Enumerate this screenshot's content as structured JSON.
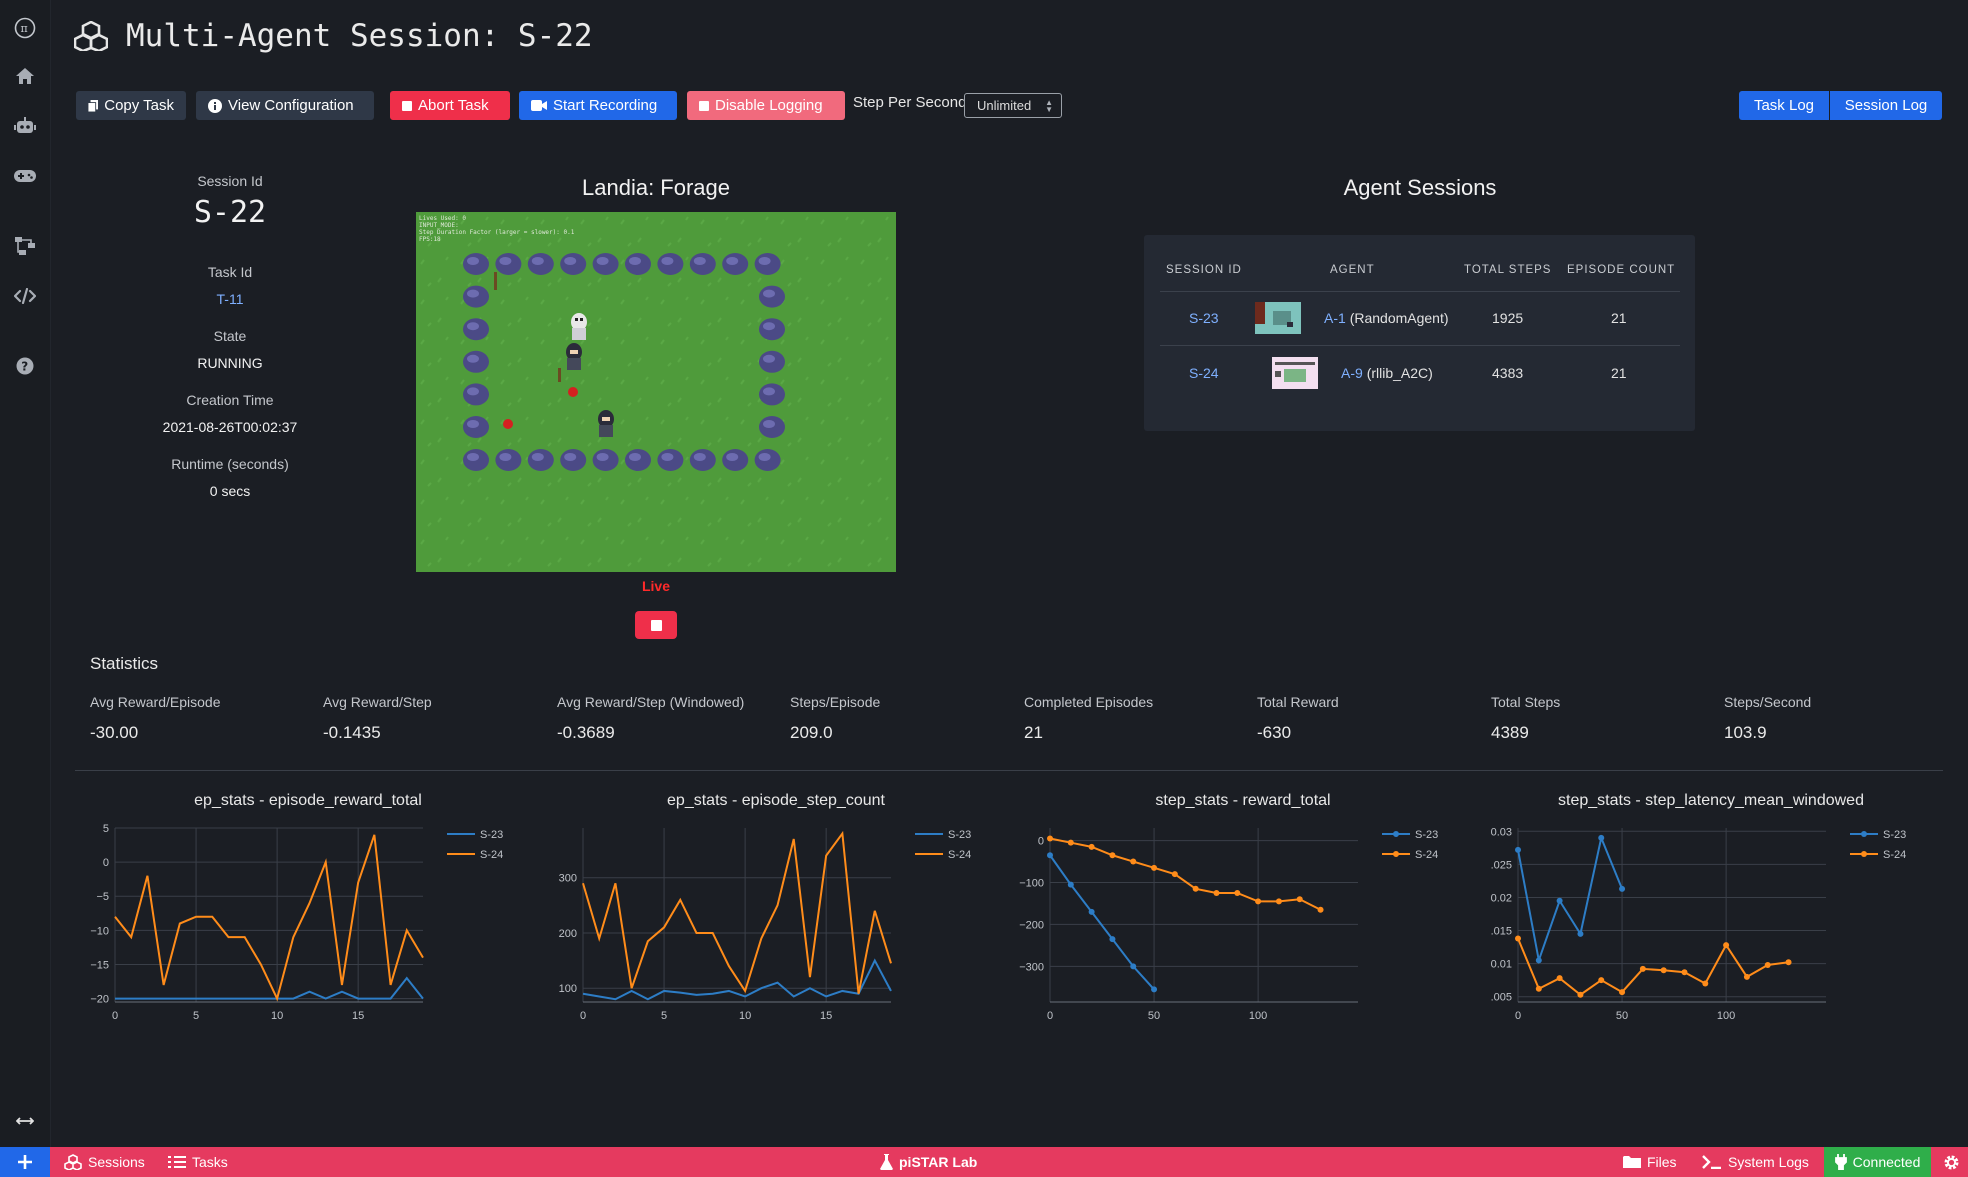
{
  "header": {
    "title": "Multi-Agent Session: S-22"
  },
  "toolbar": {
    "copy_task": "Copy Task",
    "view_config": "View Configuration",
    "abort_task": "Abort Task",
    "start_recording": "Start Recording",
    "disable_logging": "Disable Logging",
    "step_per_second_label": "Step Per Second",
    "step_per_second_value": "Unlimited",
    "task_log": "Task Log",
    "session_log": "Session Log"
  },
  "session_info": {
    "session_id_label": "Session Id",
    "session_id": "S-22",
    "task_id_label": "Task Id",
    "task_id": "T-11",
    "state_label": "State",
    "state": "RUNNING",
    "creation_time_label": "Creation Time",
    "creation_time": "2021-08-26T00:02:37",
    "runtime_label": "Runtime (seconds)",
    "runtime": "0 secs"
  },
  "game": {
    "title": "Landia: Forage",
    "status": "Live",
    "hud_lines": [
      "Lives Used: 0",
      "INPUT_MODE:",
      "Step Duration Factor (larger = slower): 0.1",
      "FPS:18"
    ]
  },
  "agent_sessions": {
    "title": "Agent Sessions",
    "columns": [
      "SESSION ID",
      "AGENT",
      "TOTAL STEPS",
      "EPISODE COUNT"
    ],
    "rows": [
      {
        "session_id": "S-23",
        "agent_id": "A-1",
        "agent_name": "(RandomAgent)",
        "total_steps": "1925",
        "episode_count": "21"
      },
      {
        "session_id": "S-24",
        "agent_id": "A-9",
        "agent_name": "(rllib_A2C)",
        "total_steps": "4383",
        "episode_count": "21"
      }
    ]
  },
  "statistics": {
    "title": "Statistics",
    "items": [
      {
        "label": "Avg Reward/Episode",
        "value": "-30.00"
      },
      {
        "label": "Avg Reward/Step",
        "value": "-0.1435"
      },
      {
        "label": "Avg Reward/Step (Windowed)",
        "value": "-0.3689"
      },
      {
        "label": "Steps/Episode",
        "value": "209.0"
      },
      {
        "label": "Completed Episodes",
        "value": "21"
      },
      {
        "label": "Total Reward",
        "value": "-630"
      },
      {
        "label": "Total Steps",
        "value": "4389"
      },
      {
        "label": "Steps/Second",
        "value": "103.9"
      }
    ]
  },
  "colors": {
    "s23": "#2d7dc6",
    "s24": "#ff8c1a",
    "accent_red": "#ef2f4a",
    "accent_blue": "#2168e8"
  },
  "chart_data": [
    {
      "type": "line",
      "title": "ep_stats - episode_reward_total",
      "xlim": [
        0,
        19
      ],
      "ylim": [
        -20.5,
        5
      ],
      "xticks": [
        0,
        5,
        10,
        15
      ],
      "yticks": [
        5,
        0,
        -5,
        -10,
        -15,
        -20
      ],
      "ytick_labels": [
        "5",
        "0",
        "−5",
        "−10",
        "−15",
        "−20"
      ],
      "markers": false,
      "series": [
        {
          "name": "S-23",
          "x": [
            0,
            1,
            2,
            3,
            4,
            5,
            6,
            7,
            8,
            9,
            10,
            11,
            12,
            13,
            14,
            15,
            16,
            17,
            18,
            19
          ],
          "y": [
            -20,
            -20,
            -20,
            -20,
            -20,
            -20,
            -20,
            -20,
            -20,
            -20,
            -20,
            -20,
            -19,
            -20,
            -19,
            -20,
            -20,
            -20,
            -17,
            -20
          ]
        },
        {
          "name": "S-24",
          "x": [
            0,
            1,
            2,
            3,
            4,
            5,
            6,
            7,
            8,
            9,
            10,
            11,
            12,
            13,
            14,
            15,
            16,
            17,
            18,
            19
          ],
          "y": [
            -8,
            -11,
            -2,
            -18,
            -9,
            -8,
            -8,
            -11,
            -11,
            -15,
            -20,
            -11,
            -6,
            0,
            -18,
            -3,
            4,
            -18,
            -10,
            -14
          ]
        }
      ]
    },
    {
      "type": "line",
      "title": "ep_stats - episode_step_count",
      "xlim": [
        0,
        19
      ],
      "ylim": [
        75,
        390
      ],
      "xticks": [
        0,
        5,
        10,
        15
      ],
      "yticks": [
        300,
        200,
        100
      ],
      "ytick_labels": [
        "300",
        "200",
        "100"
      ],
      "markers": false,
      "series": [
        {
          "name": "S-23",
          "x": [
            0,
            1,
            2,
            3,
            4,
            5,
            6,
            7,
            8,
            9,
            10,
            11,
            12,
            13,
            14,
            15,
            16,
            17,
            18,
            19
          ],
          "y": [
            90,
            85,
            80,
            95,
            80,
            95,
            92,
            88,
            90,
            95,
            85,
            100,
            110,
            85,
            100,
            85,
            95,
            90,
            150,
            95
          ]
        },
        {
          "name": "S-24",
          "x": [
            0,
            1,
            2,
            3,
            4,
            5,
            6,
            7,
            8,
            9,
            10,
            11,
            12,
            13,
            14,
            15,
            16,
            17,
            18,
            19
          ],
          "y": [
            290,
            190,
            290,
            100,
            185,
            210,
            260,
            200,
            200,
            140,
            95,
            190,
            250,
            370,
            120,
            340,
            380,
            90,
            240,
            145
          ]
        }
      ]
    },
    {
      "type": "line",
      "title": "step_stats - reward_total",
      "xlim": [
        0,
        148
      ],
      "ylim": [
        -385,
        30
      ],
      "xticks": [
        0,
        50,
        100
      ],
      "yticks": [
        0,
        -100,
        -200,
        -300
      ],
      "ytick_labels": [
        "0",
        "−100",
        "−200",
        "−300"
      ],
      "markers": true,
      "series": [
        {
          "name": "S-23",
          "x": [
            0,
            10,
            20,
            30,
            40,
            50
          ],
          "y": [
            -35,
            -105,
            -170,
            -235,
            -300,
            -355
          ]
        },
        {
          "name": "S-24",
          "x": [
            0,
            10,
            20,
            30,
            40,
            50,
            60,
            70,
            80,
            90,
            100,
            110,
            120,
            130
          ],
          "y": [
            5,
            -5,
            -15,
            -35,
            -50,
            -65,
            -80,
            -115,
            -125,
            -125,
            -145,
            -145,
            -140,
            -165
          ]
        }
      ]
    },
    {
      "type": "line",
      "title": "step_stats - step_latency_mean_windowed",
      "xlim": [
        0,
        148
      ],
      "ylim": [
        0.0042,
        0.0305
      ],
      "xticks": [
        0,
        50,
        100
      ],
      "yticks": [
        0.03,
        0.025,
        0.02,
        0.015,
        0.01,
        0.005
      ],
      "ytick_labels": [
        "0.03",
        ".025",
        "0.02",
        ".015",
        "0.01",
        ".005"
      ],
      "markers": true,
      "series": [
        {
          "name": "S-23",
          "x": [
            0,
            10,
            20,
            30,
            40,
            50
          ],
          "y": [
            0.0272,
            0.0105,
            0.0195,
            0.0145,
            0.029,
            0.0213
          ]
        },
        {
          "name": "S-24",
          "x": [
            0,
            10,
            20,
            30,
            40,
            50,
            60,
            70,
            80,
            90,
            100,
            110,
            120,
            130
          ],
          "y": [
            0.0138,
            0.0062,
            0.0078,
            0.0053,
            0.0075,
            0.0057,
            0.0092,
            0.009,
            0.0087,
            0.007,
            0.0128,
            0.008,
            0.0098,
            0.0102
          ]
        }
      ]
    }
  ],
  "bottom_bar": {
    "sessions": "Sessions",
    "tasks": "Tasks",
    "brand": "piSTAR Lab",
    "files": "Files",
    "system_logs": "System Logs",
    "connected": "Connected"
  }
}
